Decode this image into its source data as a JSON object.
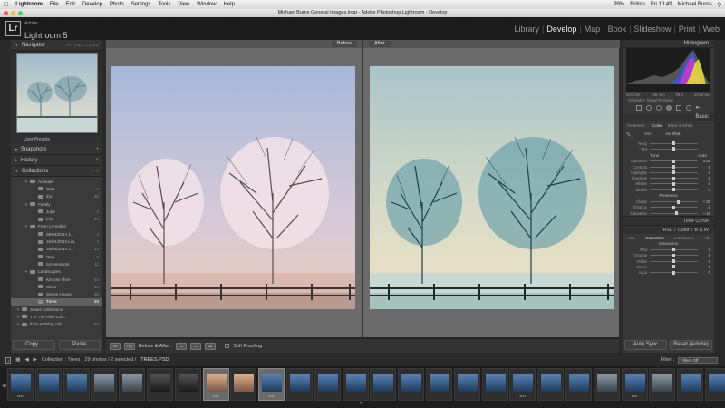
{
  "menubar": {
    "app": "Lightroom",
    "items": [
      "File",
      "Edit",
      "Develop",
      "Photo",
      "Settings",
      "Tools",
      "View",
      "Window",
      "Help"
    ],
    "battery": "99%",
    "input": "British",
    "day": "Fri 10:49",
    "user": "Michael Burns"
  },
  "window": {
    "title": "Michael Burns General Images.lrcat - Adobe Photoshop Lightroom - Develop"
  },
  "header": {
    "logo": "Lr",
    "brand_top": "Adobe",
    "brand": "Lightroom 5",
    "modules": [
      "Library",
      "Develop",
      "Map",
      "Book",
      "Slideshow",
      "Print",
      "Web"
    ],
    "active_module": "Develop"
  },
  "left_panel": {
    "navigator": {
      "title": "Navigator",
      "zoom": "FIT  FILL  1:1  3:1"
    },
    "user_presets": "User Presets",
    "snapshots": "Snapshots",
    "history": "History",
    "collections": {
      "title": "Collections",
      "items": [
        {
          "name": "Animals",
          "count": "",
          "indent": 1
        },
        {
          "name": "Cats",
          "count": "7",
          "indent": 2
        },
        {
          "name": "Zoo",
          "count": "30",
          "indent": 2
        },
        {
          "name": "Family",
          "count": "",
          "indent": 1
        },
        {
          "name": "Jude",
          "count": "2",
          "indent": 2
        },
        {
          "name": "Lila",
          "count": "37",
          "indent": 2
        },
        {
          "name": "From Lr mobile",
          "count": "",
          "indent": 1
        },
        {
          "name": "09/04/2014 1...",
          "count": "4",
          "indent": 2
        },
        {
          "name": "15/04/2014 Lila",
          "count": "4",
          "indent": 2
        },
        {
          "name": "16/05/2014 1...",
          "count": "13",
          "indent": 2
        },
        {
          "name": "Raw",
          "count": "0",
          "indent": 2
        },
        {
          "name": "Screenshots",
          "count": "11",
          "indent": 2
        },
        {
          "name": "Landscapes",
          "count": "",
          "indent": 1
        },
        {
          "name": "Kinross shire",
          "count": "64",
          "indent": 2
        },
        {
          "name": "Skies",
          "count": "16",
          "indent": 2
        },
        {
          "name": "Steam House",
          "count": "28",
          "indent": 2
        },
        {
          "name": "Trees",
          "count": "29",
          "indent": 2,
          "selected": true
        },
        {
          "name": "Smart Collections",
          "count": "",
          "indent": 0
        },
        {
          "name": "T in The Park Coll...",
          "count": "",
          "indent": 0
        },
        {
          "name": "Ibiza Holiday coll...",
          "count": "63",
          "indent": 0
        }
      ]
    },
    "copy_label": "Copy...",
    "paste_label": "Paste"
  },
  "center": {
    "before_label": "Before",
    "after_label": "After",
    "toolbar": {
      "mode_label": "Before & After :",
      "soft_proofing": "Soft Proofing",
      "yy_label": "Y|Y"
    }
  },
  "right_panel": {
    "histogram_title": "Histogram",
    "histo_info": [
      "ISO 100",
      "105 mm",
      "f/8.0",
      "1/320 sec"
    ],
    "preview_note": "Original + Smart Preview",
    "basic_title": "Basic",
    "treatment_label": "Treatment :",
    "color_label": "Color",
    "bw_label": "Black & White",
    "wb_label": "WB :",
    "wb_value": "As Shot",
    "tone_label": "Tone",
    "auto_label": "Auto",
    "presence_label": "Presence",
    "sliders_wb": [
      {
        "name": "Temp",
        "value": "",
        "pos": 0.5
      },
      {
        "name": "Tint",
        "value": "",
        "pos": 0.5
      }
    ],
    "sliders_tone": [
      {
        "name": "Exposure",
        "value": "0.00",
        "pos": 0.5
      },
      {
        "name": "Contrast",
        "value": "0",
        "pos": 0.5
      },
      {
        "name": "Highlights",
        "value": "0",
        "pos": 0.5
      },
      {
        "name": "Shadows",
        "value": "0",
        "pos": 0.5
      },
      {
        "name": "Whites",
        "value": "0",
        "pos": 0.5
      },
      {
        "name": "Blacks",
        "value": "0",
        "pos": 0.5
      }
    ],
    "sliders_presence": [
      {
        "name": "Clarity",
        "value": "+ 20",
        "pos": 0.6
      },
      {
        "name": "Vibrance",
        "value": "0",
        "pos": 0.5
      },
      {
        "name": "Saturation",
        "value": "+ 10",
        "pos": 0.55
      }
    ],
    "tone_curve": "Tone Curve",
    "hsl_tabs": [
      "HSL",
      "/",
      "Color",
      "/",
      "B & W"
    ],
    "hsl_sub": [
      "Hue",
      "Saturation",
      "Luminance",
      "All"
    ],
    "saturation_title": "Saturation",
    "sliders_hsl": [
      {
        "name": "Red",
        "value": "0",
        "pos": 0.5
      },
      {
        "name": "Orange",
        "value": "0",
        "pos": 0.5
      },
      {
        "name": "Yellow",
        "value": "0",
        "pos": 0.5
      },
      {
        "name": "Green",
        "value": "0",
        "pos": 0.5
      },
      {
        "name": "Aqua",
        "value": "0",
        "pos": 0.5
      }
    ],
    "auto_sync": "Auto Sync",
    "reset": "Reset (Adobe)"
  },
  "filmstrip_header": {
    "collection": "Collection : Trees",
    "count": "29 photos / 2 selected /",
    "file": "TREES.PSD",
    "filter_label": "Filter :",
    "filter_value": "Filters Off"
  },
  "filmstrip": {
    "thumbs": [
      {
        "stars": "••••",
        "tone": "blue"
      },
      {
        "stars": "",
        "tone": "blue"
      },
      {
        "stars": "",
        "tone": "blue"
      },
      {
        "stars": "",
        "tone": "grey"
      },
      {
        "stars": "",
        "tone": "grey"
      },
      {
        "stars": "",
        "tone": "dark"
      },
      {
        "stars": "",
        "tone": "dark"
      },
      {
        "stars": "••••",
        "tone": "warm",
        "selected": true
      },
      {
        "stars": "",
        "tone": "warm"
      },
      {
        "stars": "••••",
        "tone": "blue",
        "selected": true
      },
      {
        "stars": "",
        "tone": "blue"
      },
      {
        "stars": "",
        "tone": "blue"
      },
      {
        "stars": "",
        "tone": "blue"
      },
      {
        "stars": "",
        "tone": "blue"
      },
      {
        "stars": "",
        "tone": "blue"
      },
      {
        "stars": "",
        "tone": "blue"
      },
      {
        "stars": "",
        "tone": "blue"
      },
      {
        "stars": "",
        "tone": "blue"
      },
      {
        "stars": "••••",
        "tone": "blue"
      },
      {
        "stars": "",
        "tone": "blue"
      },
      {
        "stars": "",
        "tone": "blue"
      },
      {
        "stars": "",
        "tone": "grey"
      },
      {
        "stars": "••••",
        "tone": "blue"
      },
      {
        "stars": "",
        "tone": "grey"
      },
      {
        "stars": "",
        "tone": "blue"
      },
      {
        "stars": "",
        "tone": "blue"
      }
    ]
  }
}
